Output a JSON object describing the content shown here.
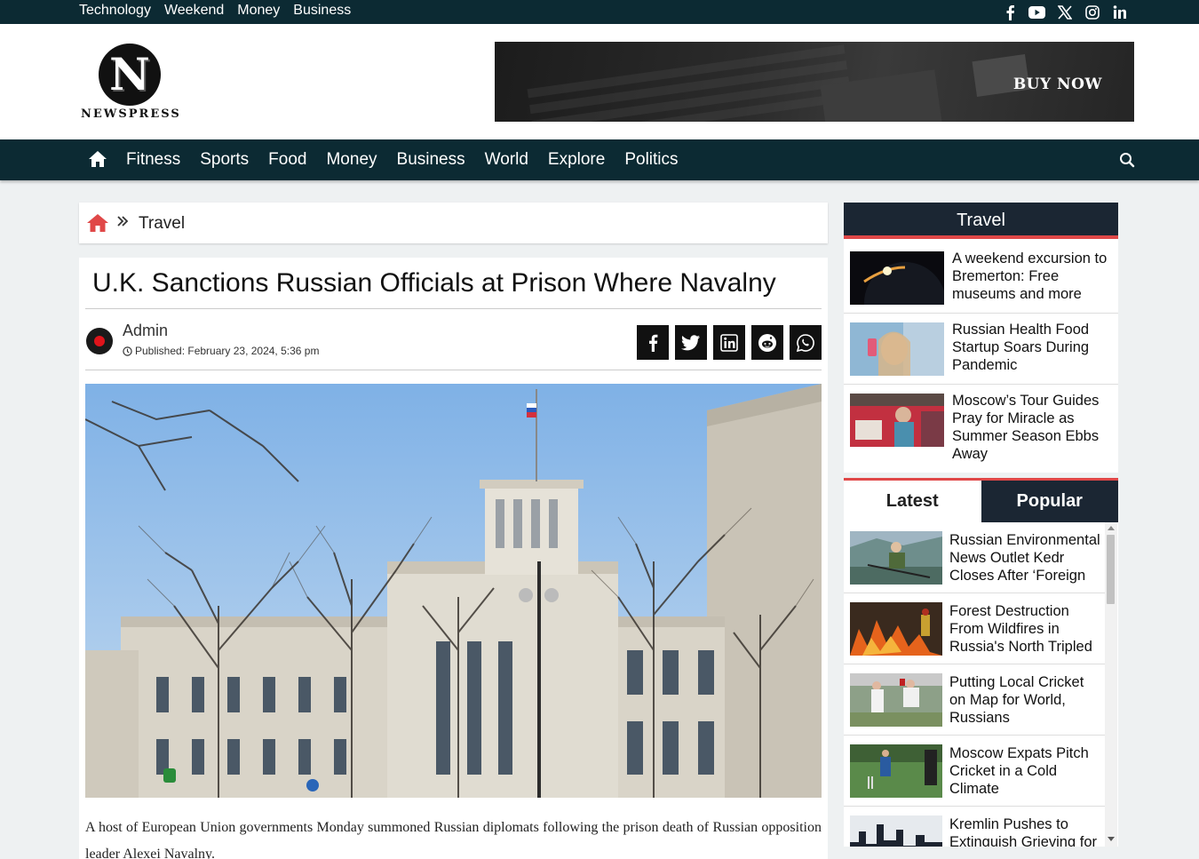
{
  "topbar": {
    "links": [
      "Technology",
      "Weekend",
      "Money",
      "Business"
    ],
    "social_icons": [
      "facebook-icon",
      "youtube-icon",
      "x-icon",
      "instagram-icon",
      "linkedin-icon"
    ]
  },
  "header": {
    "logo_letter": "N",
    "logo_word": "NEWSPRESS",
    "banner_cta": "BUY NOW"
  },
  "nav": {
    "items": [
      "Fitness",
      "Sports",
      "Food",
      "Money",
      "Business",
      "World",
      "Explore",
      "Politics"
    ]
  },
  "breadcrumb": {
    "current": "Travel"
  },
  "article": {
    "title": "U.K. Sanctions Russian Officials at Prison Where Navalny",
    "author": "Admin",
    "published": "Published: February 23, 2024, 5:36 pm",
    "share_icons": [
      "facebook-icon",
      "twitter-icon",
      "linkedin-icon",
      "reddit-icon",
      "whatsapp-icon"
    ],
    "body": "A host of European Union governments Monday summoned Russian diplomats following the prison death of Russian opposition leader Alexei Navalny."
  },
  "sidebar": {
    "section_title": "Travel",
    "travel_items": [
      "A weekend excursion to Bremerton: Free museums and more",
      "Russian Health Food Startup Soars During Pandemic",
      "Moscow’s Tour Guides Pray for Miracle as Summer Season Ebbs Away"
    ],
    "tabs": [
      "Latest",
      "Popular"
    ],
    "latest_items": [
      "Russian Environmental News Outlet Kedr Closes After ‘Foreign",
      "Forest Destruction From Wildfires in Russia's North Tripled",
      "Putting Local Cricket on Map for World, Russians",
      "Moscow Expats Pitch Cricket in a Cold Climate",
      "Kremlin Pushes to Extinguish Grieving for"
    ]
  },
  "colors": {
    "dark_bar": "#0c2a33",
    "sidebar_head": "#1b2633",
    "accent_red": "#e04848"
  }
}
